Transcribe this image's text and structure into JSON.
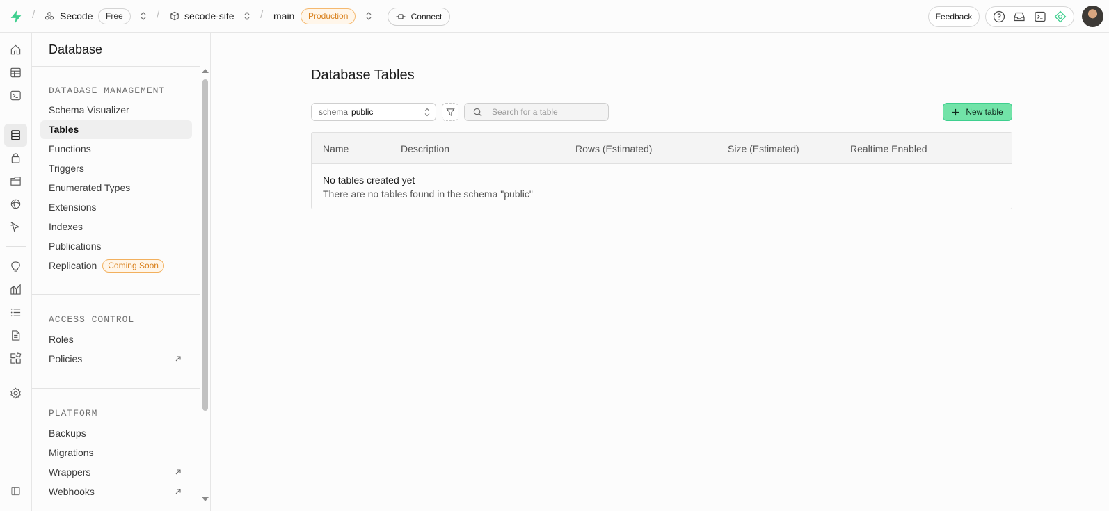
{
  "topbar": {
    "org_name": "Secode",
    "org_plan": "Free",
    "project_name": "secode-site",
    "branch_name": "main",
    "branch_env": "Production",
    "connect_label": "Connect",
    "feedback_label": "Feedback"
  },
  "sidebar": {
    "title": "Database",
    "sections": [
      {
        "heading": "DATABASE MANAGEMENT",
        "items": [
          {
            "label": "Schema Visualizer"
          },
          {
            "label": "Tables",
            "active": true
          },
          {
            "label": "Functions"
          },
          {
            "label": "Triggers"
          },
          {
            "label": "Enumerated Types"
          },
          {
            "label": "Extensions"
          },
          {
            "label": "Indexes"
          },
          {
            "label": "Publications"
          },
          {
            "label": "Replication",
            "badge": "Coming Soon"
          }
        ]
      },
      {
        "heading": "ACCESS CONTROL",
        "items": [
          {
            "label": "Roles"
          },
          {
            "label": "Policies",
            "external": true
          }
        ]
      },
      {
        "heading": "PLATFORM",
        "items": [
          {
            "label": "Backups"
          },
          {
            "label": "Migrations"
          },
          {
            "label": "Wrappers",
            "external": true
          },
          {
            "label": "Webhooks",
            "external": true
          }
        ]
      }
    ]
  },
  "main": {
    "title": "Database Tables",
    "schema_label": "schema",
    "schema_value": "public",
    "search_placeholder": "Search for a table",
    "new_table_label": "New table",
    "columns": [
      "Name",
      "Description",
      "Rows (Estimated)",
      "Size (Estimated)",
      "Realtime Enabled"
    ],
    "empty_title": "No tables created yet",
    "empty_desc": "There are no tables found in the schema \"public\""
  },
  "colors": {
    "brand": "#3ecf8e",
    "button_fill": "#72e3a8",
    "production_badge": "#d9821f"
  },
  "icons": [
    "bolt-logo-icon",
    "org-icon",
    "project-box-icon",
    "chevrons-updown-icon",
    "connect-plug-icon",
    "help-icon",
    "inbox-icon",
    "terminal-icon",
    "assistant-icon",
    "home-icon",
    "table-editor-icon",
    "sql-editor-icon",
    "database-icon",
    "auth-icon",
    "storage-icon",
    "realtime-icon",
    "edge-functions-icon",
    "advisors-icon",
    "reports-icon",
    "logs-icon",
    "api-docs-icon",
    "integrations-icon",
    "settings-icon",
    "sidebar-toggle-icon",
    "filter-icon",
    "search-icon",
    "plus-icon",
    "external-link-icon"
  ]
}
